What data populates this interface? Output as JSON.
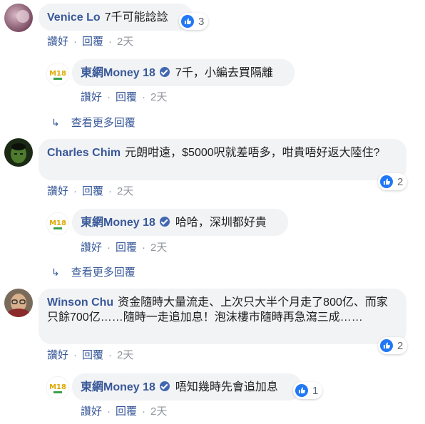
{
  "c1": {
    "author": "Venice Lo",
    "text": "7千可能諗諗",
    "likes": "3",
    "like": "讚好",
    "reply": "回覆",
    "time": "2天"
  },
  "r1": {
    "author": "東網Money 18",
    "text": "7千，小編去買隔離",
    "like": "讚好",
    "reply": "回覆",
    "time": "2天"
  },
  "more1": "查看更多回覆",
  "c2": {
    "author": "Charles Chim",
    "text": "元朗咁遠，$5000呎就差唔多，咁貴唔好返大陸住?",
    "likes": "2",
    "like": "讚好",
    "reply": "回覆",
    "time": "2天"
  },
  "r2": {
    "author": "東網Money 18",
    "text": "哈哈，深圳都好貴",
    "like": "讚好",
    "reply": "回覆",
    "time": "2天"
  },
  "more2": "查看更多回覆",
  "c3": {
    "author": "Winson Chu",
    "text": "资金隨時大量流走、上次只大半个月走了800亿、而家只餘700亿……隨時一走追加息！泡沫樓市隨時再急瀉三成……",
    "likes": "2",
    "like": "讚好",
    "reply": "回覆",
    "time": "2天"
  },
  "r3": {
    "author": "東網Money 18",
    "text": "唔知幾時先會追加息",
    "likes": "1",
    "like": "讚好",
    "reply": "回覆",
    "time": "2天"
  },
  "colors": {
    "link": "#385898",
    "bubble": "#f2f3f5",
    "like": "#2078f4"
  }
}
